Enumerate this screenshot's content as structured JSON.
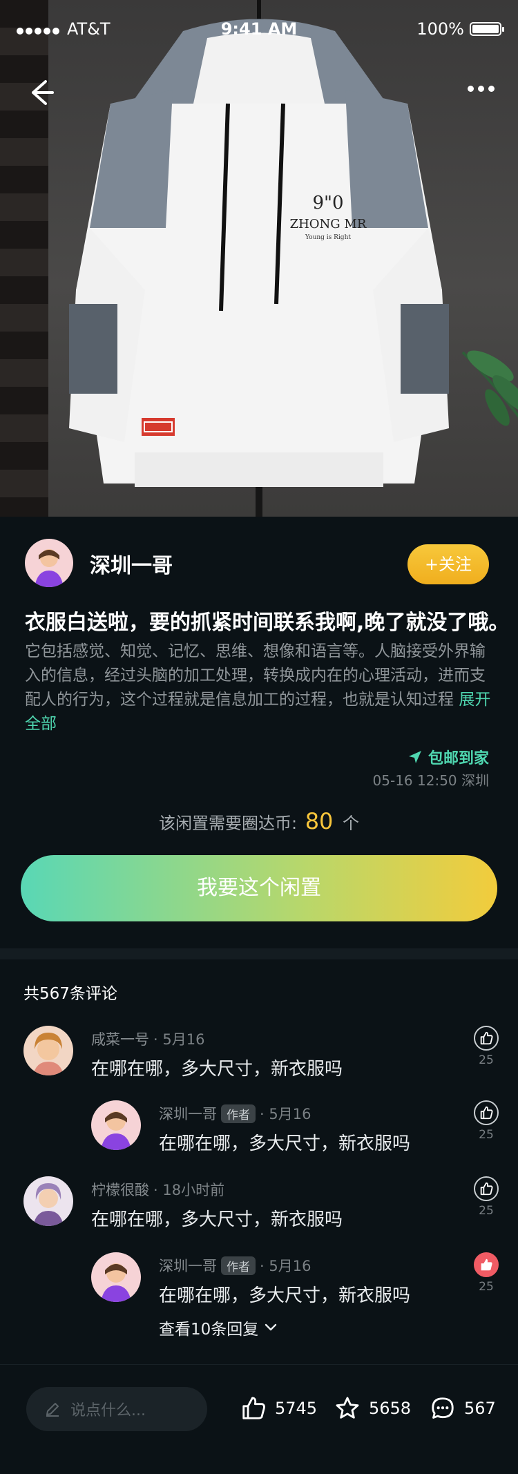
{
  "status_bar": {
    "carrier": "AT&T",
    "time": "9:41 AM",
    "battery": "100%"
  },
  "icons": {
    "back": "back-arrow-icon",
    "more": "more-dots-icon",
    "location": "navigation-arrow-icon",
    "like": "thumbs-up-icon",
    "star": "star-icon",
    "comment": "comment-bubble-icon",
    "edit": "pencil-icon",
    "chevron": "chevron-down-icon"
  },
  "post": {
    "author_name": "深圳一哥",
    "follow_label": "+关注",
    "title": "衣服白送啦，要的抓紧时间联系我啊,晚了就没了哦。",
    "description": "它包括感觉、知觉、记忆、思维、想像和语言等。人脑接受外界输入的信息，经过头脑的加工处理，转换成内在的心理活动，进而支配人的行为，这个过程就是信息加工的过程，也就是认知过程",
    "expand_label": "展开全部",
    "shipping_label": "包邮到家",
    "meta": "05-16 12:50 深圳",
    "coin_prefix": "该闲置需要圈达币:",
    "coin_amount": "80",
    "coin_unit": "个",
    "want_button": "我要这个闲置"
  },
  "comments": {
    "count_label": "共567条评论",
    "author_tag": "作者",
    "items": [
      {
        "name": "咸菜一号",
        "time": "· 5月16",
        "text": "在哪在哪，多大尺寸，新衣服吗",
        "likes": "25",
        "liked": false
      },
      {
        "name": "深圳一哥",
        "time": "· 5月16",
        "text": "在哪在哪，多大尺寸，新衣服吗",
        "likes": "25",
        "liked": false,
        "is_author": true
      },
      {
        "name": "柠檬很酸",
        "time": "· 18小时前",
        "text": "在哪在哪，多大尺寸，新衣服吗",
        "likes": "25",
        "liked": false
      },
      {
        "name": "深圳一哥",
        "time": "· 5月16",
        "text": "在哪在哪，多大尺寸，新衣服吗",
        "likes": "25",
        "liked": true,
        "is_author": true
      }
    ],
    "view_replies": "查看10条回复"
  },
  "bottom_bar": {
    "input_placeholder": "说点什么...",
    "likes": "5745",
    "favorites": "5658",
    "comments": "567"
  },
  "colors": {
    "accent_green": "#4fd7b0",
    "accent_yellow": "#f7c53b",
    "background": "#0b1216",
    "like_active": "#f05b64"
  }
}
